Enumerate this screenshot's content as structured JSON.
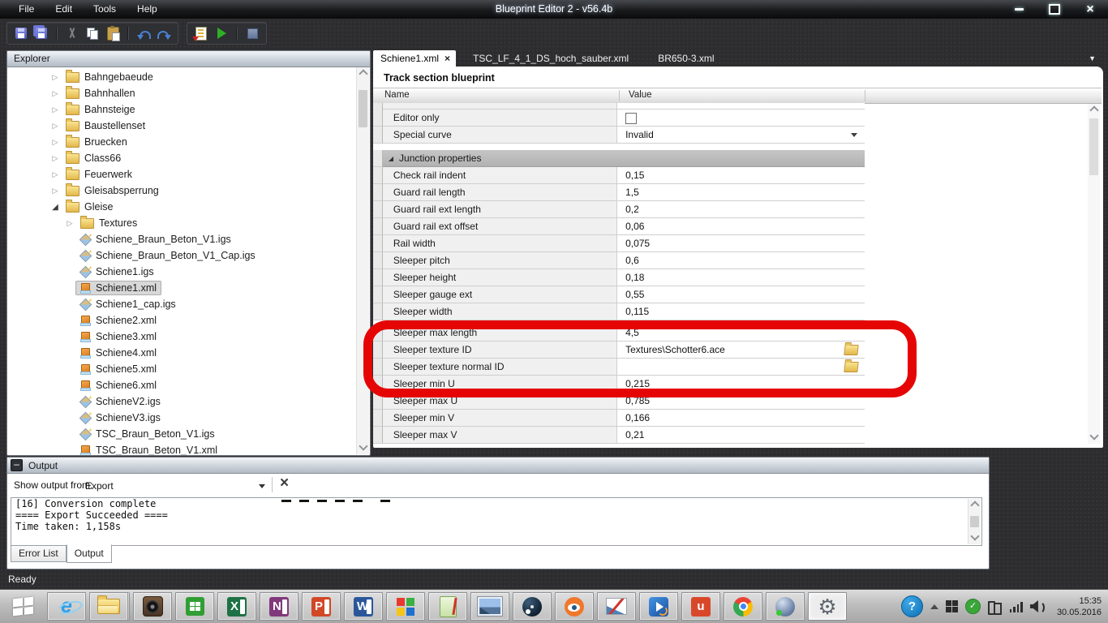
{
  "window": {
    "title": "Blueprint Editor 2 - v56.4b",
    "menus": [
      "File",
      "Edit",
      "Tools",
      "Help"
    ],
    "controls": {
      "minimize": "–",
      "maximize": "□",
      "close": "×"
    }
  },
  "toolbar": {
    "groups": [
      [
        "save",
        "save-all",
        "|",
        "cut",
        "copy",
        "paste",
        "|",
        "undo",
        "redo"
      ],
      [
        "export",
        "run",
        "|",
        "stop"
      ]
    ]
  },
  "explorer": {
    "title": "Explorer",
    "items": [
      {
        "label": "Bahngebaeude",
        "icon": "folder",
        "arrow": "collapsed",
        "indent": 1
      },
      {
        "label": "Bahnhallen",
        "icon": "folder",
        "arrow": "collapsed",
        "indent": 1
      },
      {
        "label": "Bahnsteige",
        "icon": "folder",
        "arrow": "collapsed",
        "indent": 1
      },
      {
        "label": "Baustellenset",
        "icon": "folder",
        "arrow": "collapsed",
        "indent": 1
      },
      {
        "label": "Bruecken",
        "icon": "folder",
        "arrow": "collapsed",
        "indent": 1
      },
      {
        "label": "Class66",
        "icon": "folder",
        "arrow": "collapsed",
        "indent": 1
      },
      {
        "label": "Feuerwerk",
        "icon": "folder",
        "arrow": "collapsed",
        "indent": 1
      },
      {
        "label": "Gleisabsperrung",
        "icon": "folder",
        "arrow": "collapsed",
        "indent": 1
      },
      {
        "label": "Gleise",
        "icon": "folder",
        "arrow": "expanded",
        "indent": 1
      },
      {
        "label": "Textures",
        "icon": "folder",
        "arrow": "collapsed",
        "indent": 2
      },
      {
        "label": "Schiene_Braun_Beton_V1.igs",
        "icon": "igs",
        "indent": 2
      },
      {
        "label": "Schiene_Braun_Beton_V1_Cap.igs",
        "icon": "igs",
        "indent": 2
      },
      {
        "label": "Schiene1.igs",
        "icon": "igs",
        "indent": 2
      },
      {
        "label": "Schiene1.xml",
        "icon": "xml",
        "indent": 2,
        "selected": true
      },
      {
        "label": "Schiene1_cap.igs",
        "icon": "igs",
        "indent": 2
      },
      {
        "label": "Schiene2.xml",
        "icon": "xml",
        "indent": 2
      },
      {
        "label": "Schiene3.xml",
        "icon": "xml",
        "indent": 2
      },
      {
        "label": "Schiene4.xml",
        "icon": "xml",
        "indent": 2
      },
      {
        "label": "Schiene5.xml",
        "icon": "xml",
        "indent": 2
      },
      {
        "label": "Schiene6.xml",
        "icon": "xml",
        "indent": 2
      },
      {
        "label": "SchieneV2.igs",
        "icon": "igs",
        "indent": 2
      },
      {
        "label": "SchieneV3.igs",
        "icon": "igs",
        "indent": 2
      },
      {
        "label": "TSC_Braun_Beton_V1.igs",
        "icon": "igs",
        "indent": 2
      },
      {
        "label": "TSC_Braun_Beton_V1.xml",
        "icon": "xml",
        "indent": 2
      }
    ]
  },
  "document": {
    "tabs": [
      {
        "label": "Schiene1.xml",
        "active": true,
        "close": "×"
      },
      {
        "label": "TSC_LF_4_1_DS_hoch_sauber.xml"
      },
      {
        "label": "BR650-3.xml"
      }
    ],
    "dropdown_glyph": "▼",
    "header": "Track section blueprint",
    "columns": [
      "Name",
      "Value"
    ],
    "grid_rows": [
      {
        "kind": "gap",
        "h": 8,
        "cells": true
      },
      {
        "kind": "prop",
        "name": "Editor only",
        "control": "checkbox",
        "checked": false
      },
      {
        "kind": "prop",
        "name": "Special curve",
        "control": "dropdown",
        "value": "Invalid"
      },
      {
        "kind": "gap",
        "h": 8,
        "cells": false
      },
      {
        "kind": "section",
        "label": "Junction properties"
      },
      {
        "kind": "prop",
        "name": "Check rail indent",
        "value": "0,15"
      },
      {
        "kind": "prop",
        "name": "Guard rail length",
        "value": "1,5"
      },
      {
        "kind": "prop",
        "name": "Guard rail ext length",
        "value": "0,2"
      },
      {
        "kind": "prop",
        "name": "Guard rail ext offset",
        "value": "0,06"
      },
      {
        "kind": "prop",
        "name": "Rail width",
        "value": "0,075"
      },
      {
        "kind": "prop",
        "name": "Sleeper pitch",
        "value": "0,6"
      },
      {
        "kind": "prop",
        "name": "Sleeper height",
        "value": "0,18"
      },
      {
        "kind": "prop",
        "name": "Sleeper gauge ext",
        "value": "0,55"
      },
      {
        "kind": "prop",
        "name": "Sleeper width",
        "value": "0,115"
      },
      {
        "kind": "gap",
        "h": 5,
        "cells": false
      },
      {
        "kind": "prop",
        "name": "Sleeper max length",
        "value": "4,5"
      },
      {
        "kind": "prop",
        "name": "Sleeper texture ID",
        "value": "Textures\\Schotter6.ace",
        "control": "file"
      },
      {
        "kind": "prop",
        "name": "Sleeper texture normal ID",
        "value": "",
        "control": "file"
      },
      {
        "kind": "prop",
        "name": "Sleeper min U",
        "value": "0,215"
      },
      {
        "kind": "prop",
        "name": "Sleeper max U",
        "value": "0,785"
      },
      {
        "kind": "prop",
        "name": "Sleeper min V",
        "value": "0,166"
      },
      {
        "kind": "prop",
        "name": "Sleeper max V",
        "value": "0,21"
      }
    ],
    "annotation_color": "#e60505"
  },
  "output": {
    "title": "Output",
    "minimize_glyph": "–",
    "filter_label": "Show output from:",
    "filter_value": "Export",
    "clear_glyph": "×",
    "console_lines": [
      "[16] Conversion complete",
      "==== Export Succeeded ====",
      "Time taken: 1,158s"
    ],
    "console_clipped_marks": 6,
    "tabs": [
      {
        "label": "Error List"
      },
      {
        "label": "Output",
        "active": true
      }
    ]
  },
  "statusbar": {
    "text": "Ready"
  },
  "taskbar": {
    "apps": [
      {
        "name": "internet-explorer",
        "kind": "ie",
        "glyph": "e"
      },
      {
        "name": "file-explorer",
        "kind": "folder",
        "stacked": true
      },
      {
        "name": "audio-app",
        "kind": "audio"
      },
      {
        "name": "windows-store",
        "kind": "store",
        "color": "#2f9e33"
      },
      {
        "name": "excel",
        "kind": "tile",
        "color": "#1e7145",
        "letter": "X",
        "page": true
      },
      {
        "name": "onenote",
        "kind": "tile",
        "color": "#80397b",
        "letter": "N",
        "page": true
      },
      {
        "name": "powerpoint",
        "kind": "tile",
        "color": "#d24726",
        "letter": "P",
        "page": true
      },
      {
        "name": "word",
        "kind": "tile",
        "color": "#2b579a",
        "letter": "W",
        "page": true
      },
      {
        "name": "color-squares-app",
        "kind": "squares",
        "colors": [
          "#e8392e",
          "#3bb143",
          "#f5c518",
          "#1f6fd0"
        ]
      },
      {
        "name": "notes-app",
        "kind": "notes"
      },
      {
        "name": "photo-viewer",
        "kind": "photo"
      },
      {
        "name": "steam",
        "kind": "steam"
      },
      {
        "name": "blender",
        "kind": "blender"
      },
      {
        "name": "image-editor",
        "kind": "paint"
      },
      {
        "name": "media-player",
        "kind": "media"
      },
      {
        "name": "red-tile-app",
        "kind": "tile",
        "color": "#d9472b",
        "letter": "u",
        "page": false
      },
      {
        "name": "chrome",
        "kind": "chrome"
      },
      {
        "name": "teamspeak",
        "kind": "teamspeak"
      },
      {
        "name": "blueprint-editor",
        "kind": "gear",
        "active": true,
        "glyph": "⚙"
      }
    ],
    "tray": {
      "time": "15:35",
      "date": "30.05.2016"
    }
  }
}
